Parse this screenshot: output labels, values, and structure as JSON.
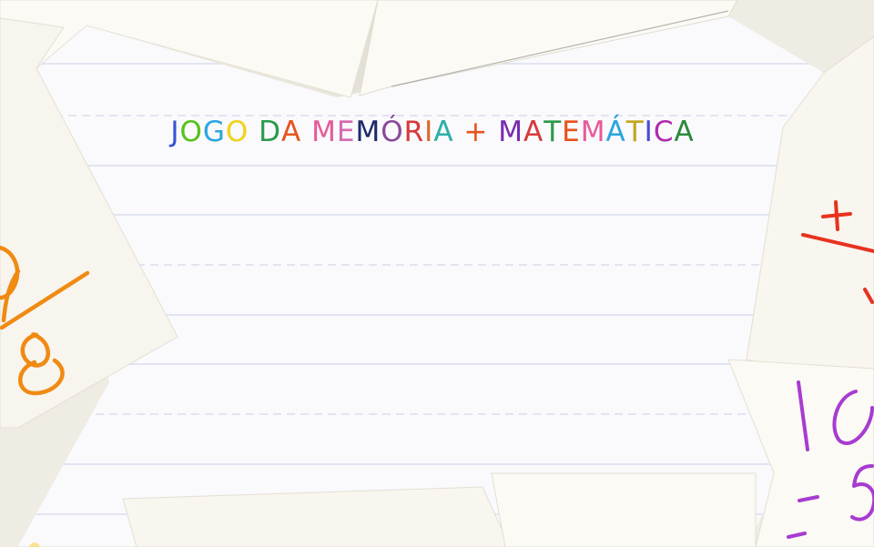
{
  "title": {
    "text": "JOGO DA MEMÓRIA + MATEMÁTICA",
    "letter_colors": [
      "#3a52d8",
      "#56c21a",
      "#2aa6e0",
      "#f0d41c",
      "#ffffff",
      "#2a9c4c",
      "#e8541c",
      "#ffffff",
      "#e85a9a",
      "#d86ab0",
      "#1c2a6a",
      "#8a4a9a",
      "#d83a3a",
      "#e06a28",
      "#2ab0a8",
      "#ffffff",
      "#e8541c",
      "#ffffff",
      "#7a2ab0",
      "#d83a3a",
      "#2a9c4c",
      "#e8541c",
      "#e85a9a",
      "#2aa6e0",
      "#c2a81c",
      "#4a4ad8",
      "#b02ab0",
      "#2a8a3a"
    ]
  },
  "cards": {
    "left_card_text": "9/8",
    "right_card_top_text": "+",
    "right_card_bottom_numbers": [
      "10",
      "-5",
      "-"
    ]
  },
  "colors": {
    "background": "#efece4",
    "paper": "#fafafd",
    "paper_line": "#d3d8ea",
    "card": "#fbfaf4",
    "left_card_ink": "#f08a12",
    "right_card_red": "#e8321e",
    "right_card_purple": "#a73cd0"
  }
}
